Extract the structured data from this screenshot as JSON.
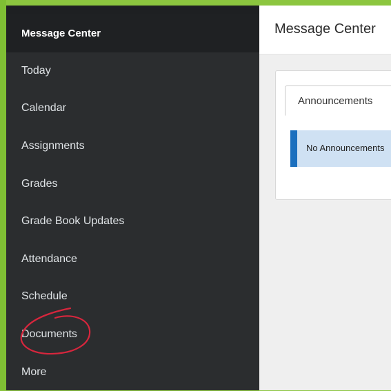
{
  "sidebar": {
    "items": [
      {
        "label": "Message Center",
        "active": true
      },
      {
        "label": "Today"
      },
      {
        "label": "Calendar"
      },
      {
        "label": "Assignments"
      },
      {
        "label": "Grades"
      },
      {
        "label": "Grade Book Updates"
      },
      {
        "label": "Attendance"
      },
      {
        "label": "Schedule"
      },
      {
        "label": "Documents"
      },
      {
        "label": "More"
      }
    ]
  },
  "main": {
    "title": "Message Center",
    "tabs": [
      {
        "label": "Announcements",
        "selected": true
      }
    ],
    "notice": "No Announcements"
  },
  "colors": {
    "background_green": "#8cc63f",
    "sidebar_bg": "#2b2d2f",
    "sidebar_active_bg": "#1f2123",
    "notice_bg": "#cfe1f3",
    "notice_accent": "#1b6fbe",
    "annotation_red": "#d7263d"
  },
  "annotations": [
    {
      "type": "hand-drawn-circle",
      "target": "Documents",
      "color": "#d7263d"
    }
  ]
}
